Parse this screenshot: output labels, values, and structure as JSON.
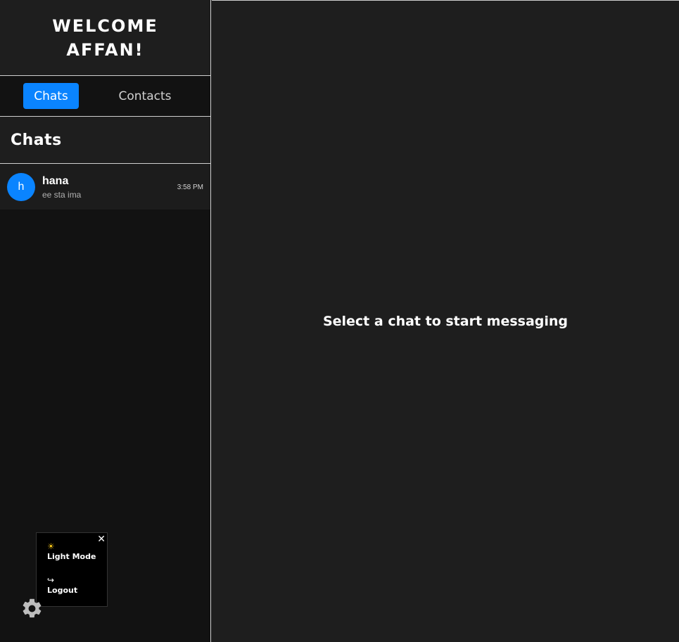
{
  "sidebar": {
    "welcome": "WELCOME AFFAN!",
    "tabs": [
      {
        "label": "Chats",
        "active": true
      },
      {
        "label": "Contacts",
        "active": false
      }
    ],
    "section_title": "Chats",
    "chats": [
      {
        "avatar_letter": "h",
        "name": "hana",
        "preview": "ee sta ima",
        "time": "3:58 PM"
      }
    ]
  },
  "settings_popup": {
    "close": "✕",
    "items": [
      {
        "icon": "sun-icon",
        "glyph": "☀",
        "label": "Light Mode"
      },
      {
        "icon": "logout-icon",
        "glyph": "↪",
        "label": "Logout"
      }
    ]
  },
  "main": {
    "placeholder": "Select a chat to start messaging"
  },
  "colors": {
    "accent": "#0a84ff",
    "background": "#1e1e1e",
    "sidebar_bg": "#121212",
    "border": "#cfcfcf"
  }
}
